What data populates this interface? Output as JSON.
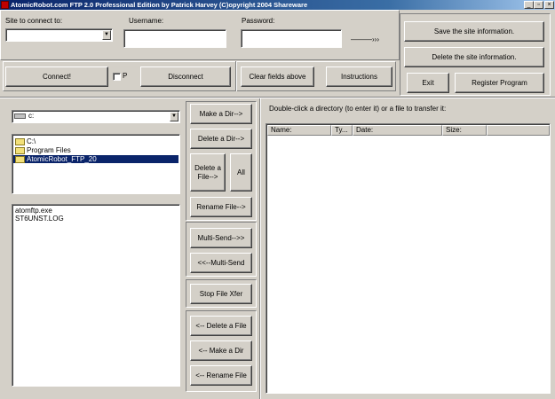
{
  "titlebar": {
    "title": "AtomicRobot.com  FTP  2.0 Professional Edition by Patrick Harvey (C)opyright 2004 Shareware",
    "minimize": "_",
    "maximize": "▫",
    "close": "×"
  },
  "connection": {
    "site_label": "Site to connect to:",
    "site_value": "",
    "username_label": "Username:",
    "username_value": "",
    "password_label": "Password:",
    "password_value": "",
    "arrow": "———›››"
  },
  "actions": {
    "save_site": "Save the site information.",
    "delete_site": "Delete the site information.",
    "exit": "Exit",
    "register": "Register Program",
    "connect": "Connect!",
    "p_checkbox": "P",
    "disconnect": "Disconnect",
    "clear_fields": "Clear fields above",
    "instructions": "Instructions"
  },
  "local": {
    "drive": "c:",
    "folders": [
      "C:\\",
      "Program Files",
      "AtomicRobot_FTP_20"
    ],
    "files": [
      "atomftp.exe",
      "ST6UNST.LOG"
    ]
  },
  "transfer": {
    "make_dir_right": "Make a Dir-->",
    "delete_dir_right": "Delete a Dir-->",
    "delete_file_right": "Delete a File-->",
    "all": "All",
    "rename_file_right": "Rename File-->",
    "multi_send_right": "Multi-Send-->>",
    "multi_send_left": "<<--Multi-Send",
    "stop_xfer": "Stop File Xfer",
    "delete_file_left": "<-- Delete a File",
    "make_dir_left": "<-- Make a Dir",
    "rename_file_left": "<-- Rename File"
  },
  "remote": {
    "instruction": "Double-click a directory (to enter it) or a file to transfer it:",
    "columns": [
      "Name:",
      "Ty...",
      "Date:",
      "Size:"
    ]
  }
}
